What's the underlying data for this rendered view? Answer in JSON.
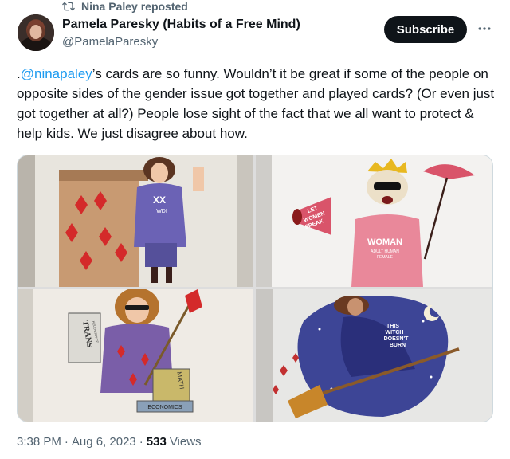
{
  "repost": {
    "label": "Nina Paley reposted",
    "icon": "repost-icon"
  },
  "author": {
    "name": "Pamela Paresky (Habits of a Free Mind)",
    "handle": "@PamelaParesky",
    "avatar": "author-avatar"
  },
  "subscribe_label": "Subscribe",
  "more_icon": "more-icon",
  "tweet": {
    "prefix": ".",
    "mention": "@ninapaley",
    "body": "’s cards are so funny. Wouldn’t it be great if some of the people on opposite sides of the gender issue got together and played cards? (Or even just got together at all?) People lose sight of the fact that we all want to protect & help kids. We just disagree about how."
  },
  "media": {
    "images": [
      {
        "caption_lines": [
          "WDI"
        ]
      },
      {
        "caption_lines": [
          "LET",
          "WOMEN",
          "SPEAK",
          "WOMAN",
          "ADULT HUMAN",
          "FEMALE"
        ]
      },
      {
        "caption_lines": [
          "TRANS",
          "HELEN JOYCE",
          "MATH",
          "ECONOMICS"
        ]
      },
      {
        "caption_lines": [
          "THIS",
          "WITCH",
          "DOESN'T",
          "BURN"
        ]
      }
    ]
  },
  "meta": {
    "time": "3:38 PM",
    "sep1": "·",
    "date": "Aug 6, 2023",
    "sep2": "·",
    "views_count": "533",
    "views_label": "Views"
  },
  "colors": {
    "accent": "#1d9bf0",
    "secondary_text": "#536471",
    "button_bg": "#0f1419"
  }
}
